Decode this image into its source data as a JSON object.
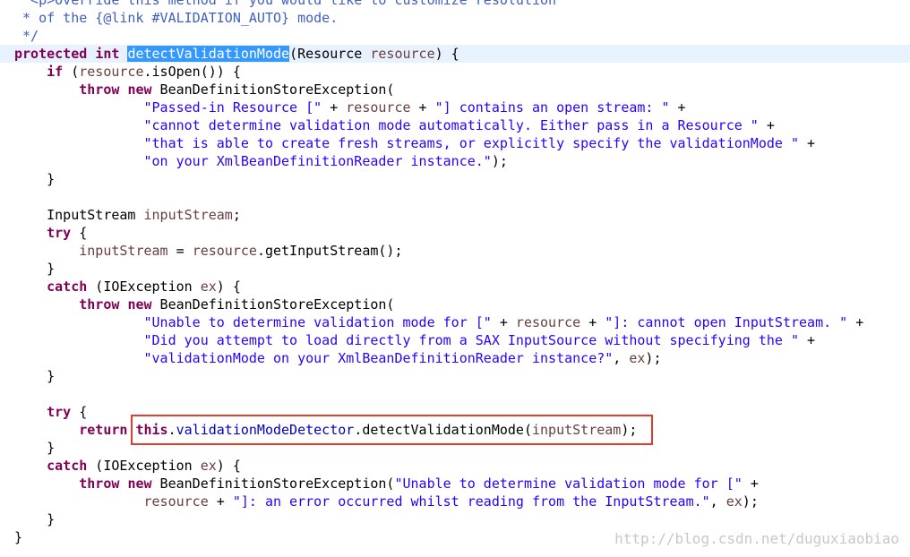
{
  "editor": {
    "lines": [
      [
        {
          "t": "  <p>Override this method if you would like to customize resolution",
          "c": "comment"
        }
      ],
      [
        {
          "t": " * of the {@link #VALIDATION_AUTO} mode.",
          "c": "comment"
        }
      ],
      [
        {
          "t": " */",
          "c": "comment"
        }
      ],
      [
        {
          "t": "protected",
          "c": "kw"
        },
        {
          "t": " "
        },
        {
          "t": "int",
          "c": "kw"
        },
        {
          "t": " "
        },
        {
          "t": "detectValidationMode",
          "c": "sel"
        },
        {
          "t": "(Resource "
        },
        {
          "t": "resource",
          "c": "param"
        },
        {
          "t": ") {"
        }
      ],
      [
        {
          "t": "    "
        },
        {
          "t": "if",
          "c": "kw"
        },
        {
          "t": " ("
        },
        {
          "t": "resource",
          "c": "param"
        },
        {
          "t": ".isOpen()) {"
        }
      ],
      [
        {
          "t": "        "
        },
        {
          "t": "throw",
          "c": "kw"
        },
        {
          "t": " "
        },
        {
          "t": "new",
          "c": "kw"
        },
        {
          "t": " BeanDefinitionStoreException("
        }
      ],
      [
        {
          "t": "                "
        },
        {
          "t": "\"Passed-in Resource [\"",
          "c": "str"
        },
        {
          "t": " + "
        },
        {
          "t": "resource",
          "c": "param"
        },
        {
          "t": " + "
        },
        {
          "t": "\"] contains an open stream: \"",
          "c": "str"
        },
        {
          "t": " +"
        }
      ],
      [
        {
          "t": "                "
        },
        {
          "t": "\"cannot determine validation mode automatically. Either pass in a Resource \"",
          "c": "str"
        },
        {
          "t": " +"
        }
      ],
      [
        {
          "t": "                "
        },
        {
          "t": "\"that is able to create fresh streams, or explicitly specify the validationMode \"",
          "c": "str"
        },
        {
          "t": " +"
        }
      ],
      [
        {
          "t": "                "
        },
        {
          "t": "\"on your XmlBeanDefinitionReader instance.\"",
          "c": "str"
        },
        {
          "t": ");"
        }
      ],
      [
        {
          "t": "    }"
        }
      ],
      [
        {
          "t": ""
        }
      ],
      [
        {
          "t": "    InputStream "
        },
        {
          "t": "inputStream",
          "c": "param"
        },
        {
          "t": ";"
        }
      ],
      [
        {
          "t": "    "
        },
        {
          "t": "try",
          "c": "kw"
        },
        {
          "t": " {"
        }
      ],
      [
        {
          "t": "        "
        },
        {
          "t": "inputStream",
          "c": "param"
        },
        {
          "t": " = "
        },
        {
          "t": "resource",
          "c": "param"
        },
        {
          "t": ".getInputStream();"
        }
      ],
      [
        {
          "t": "    }"
        }
      ],
      [
        {
          "t": "    "
        },
        {
          "t": "catch",
          "c": "kw"
        },
        {
          "t": " (IOException "
        },
        {
          "t": "ex",
          "c": "param"
        },
        {
          "t": ") {"
        }
      ],
      [
        {
          "t": "        "
        },
        {
          "t": "throw",
          "c": "kw"
        },
        {
          "t": " "
        },
        {
          "t": "new",
          "c": "kw"
        },
        {
          "t": " BeanDefinitionStoreException("
        }
      ],
      [
        {
          "t": "                "
        },
        {
          "t": "\"Unable to determine validation mode for [\"",
          "c": "str"
        },
        {
          "t": " + "
        },
        {
          "t": "resource",
          "c": "param"
        },
        {
          "t": " + "
        },
        {
          "t": "\"]: cannot open InputStream. \"",
          "c": "str"
        },
        {
          "t": " +"
        }
      ],
      [
        {
          "t": "                "
        },
        {
          "t": "\"Did you attempt to load directly from a SAX InputSource without specifying the \"",
          "c": "str"
        },
        {
          "t": " +"
        }
      ],
      [
        {
          "t": "                "
        },
        {
          "t": "\"validationMode on your XmlBeanDefinitionReader instance?\"",
          "c": "str"
        },
        {
          "t": ", "
        },
        {
          "t": "ex",
          "c": "param"
        },
        {
          "t": ");"
        }
      ],
      [
        {
          "t": "    }"
        }
      ],
      [
        {
          "t": ""
        }
      ],
      [
        {
          "t": "    "
        },
        {
          "t": "try",
          "c": "kw"
        },
        {
          "t": " {"
        }
      ],
      [
        {
          "t": "        "
        },
        {
          "t": "return",
          "c": "kw"
        },
        {
          "t": " "
        },
        {
          "t": "this",
          "c": "kw"
        },
        {
          "t": "."
        },
        {
          "t": "validationModeDetector",
          "c": "field"
        },
        {
          "t": ".detectValidationMode("
        },
        {
          "t": "inputStream",
          "c": "param"
        },
        {
          "t": ");"
        }
      ],
      [
        {
          "t": "    }"
        }
      ],
      [
        {
          "t": "    "
        },
        {
          "t": "catch",
          "c": "kw"
        },
        {
          "t": " (IOException "
        },
        {
          "t": "ex",
          "c": "param"
        },
        {
          "t": ") {"
        }
      ],
      [
        {
          "t": "        "
        },
        {
          "t": "throw",
          "c": "kw"
        },
        {
          "t": " "
        },
        {
          "t": "new",
          "c": "kw"
        },
        {
          "t": " BeanDefinitionStoreException("
        },
        {
          "t": "\"Unable to determine validation mode for [\"",
          "c": "str"
        },
        {
          "t": " +"
        }
      ],
      [
        {
          "t": "                "
        },
        {
          "t": "resource",
          "c": "param"
        },
        {
          "t": " + "
        },
        {
          "t": "\"]: an error occurred whilst reading from the InputStream.\"",
          "c": "str"
        },
        {
          "t": ", "
        },
        {
          "t": "ex",
          "c": "param"
        },
        {
          "t": ");"
        }
      ],
      [
        {
          "t": "    }"
        }
      ],
      [
        {
          "t": "}"
        }
      ]
    ],
    "current_line_index": 3,
    "highlighted_line_index": 24
  },
  "watermark": "http://blog.csdn.net/duguxiaobiao",
  "colors": {
    "keyword": "#7f0055",
    "string": "#2a00ff",
    "field": "#0000c0",
    "comment": "#3f5fbf",
    "variable": "#6a3e3e",
    "selection": "#3399ff",
    "current_line": "#e8f2fe",
    "highlight_box": "#e03c31"
  }
}
